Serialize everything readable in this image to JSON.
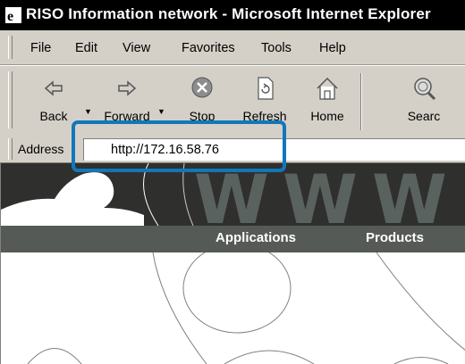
{
  "window": {
    "title": "RISO Information network - Microsoft Internet Explorer"
  },
  "menu": {
    "items": [
      {
        "label": "File"
      },
      {
        "label": "Edit"
      },
      {
        "label": "View"
      },
      {
        "label": "Favorites"
      },
      {
        "label": "Tools"
      },
      {
        "label": "Help"
      }
    ]
  },
  "toolbar": {
    "back_label": "Back",
    "forward_label": "Forward",
    "stop_label": "Stop",
    "refresh_label": "Refresh",
    "home_label": "Home",
    "search_label": "Searc"
  },
  "address": {
    "label": "Address",
    "url": "http://172.16.58.76"
  },
  "page": {
    "nav": [
      "Applications",
      "Products"
    ],
    "banner_letters": [
      "W",
      "W",
      "W"
    ]
  },
  "colors": {
    "highlight": "#1177bb",
    "banner": "#2f302d",
    "navband": "#565a57"
  }
}
